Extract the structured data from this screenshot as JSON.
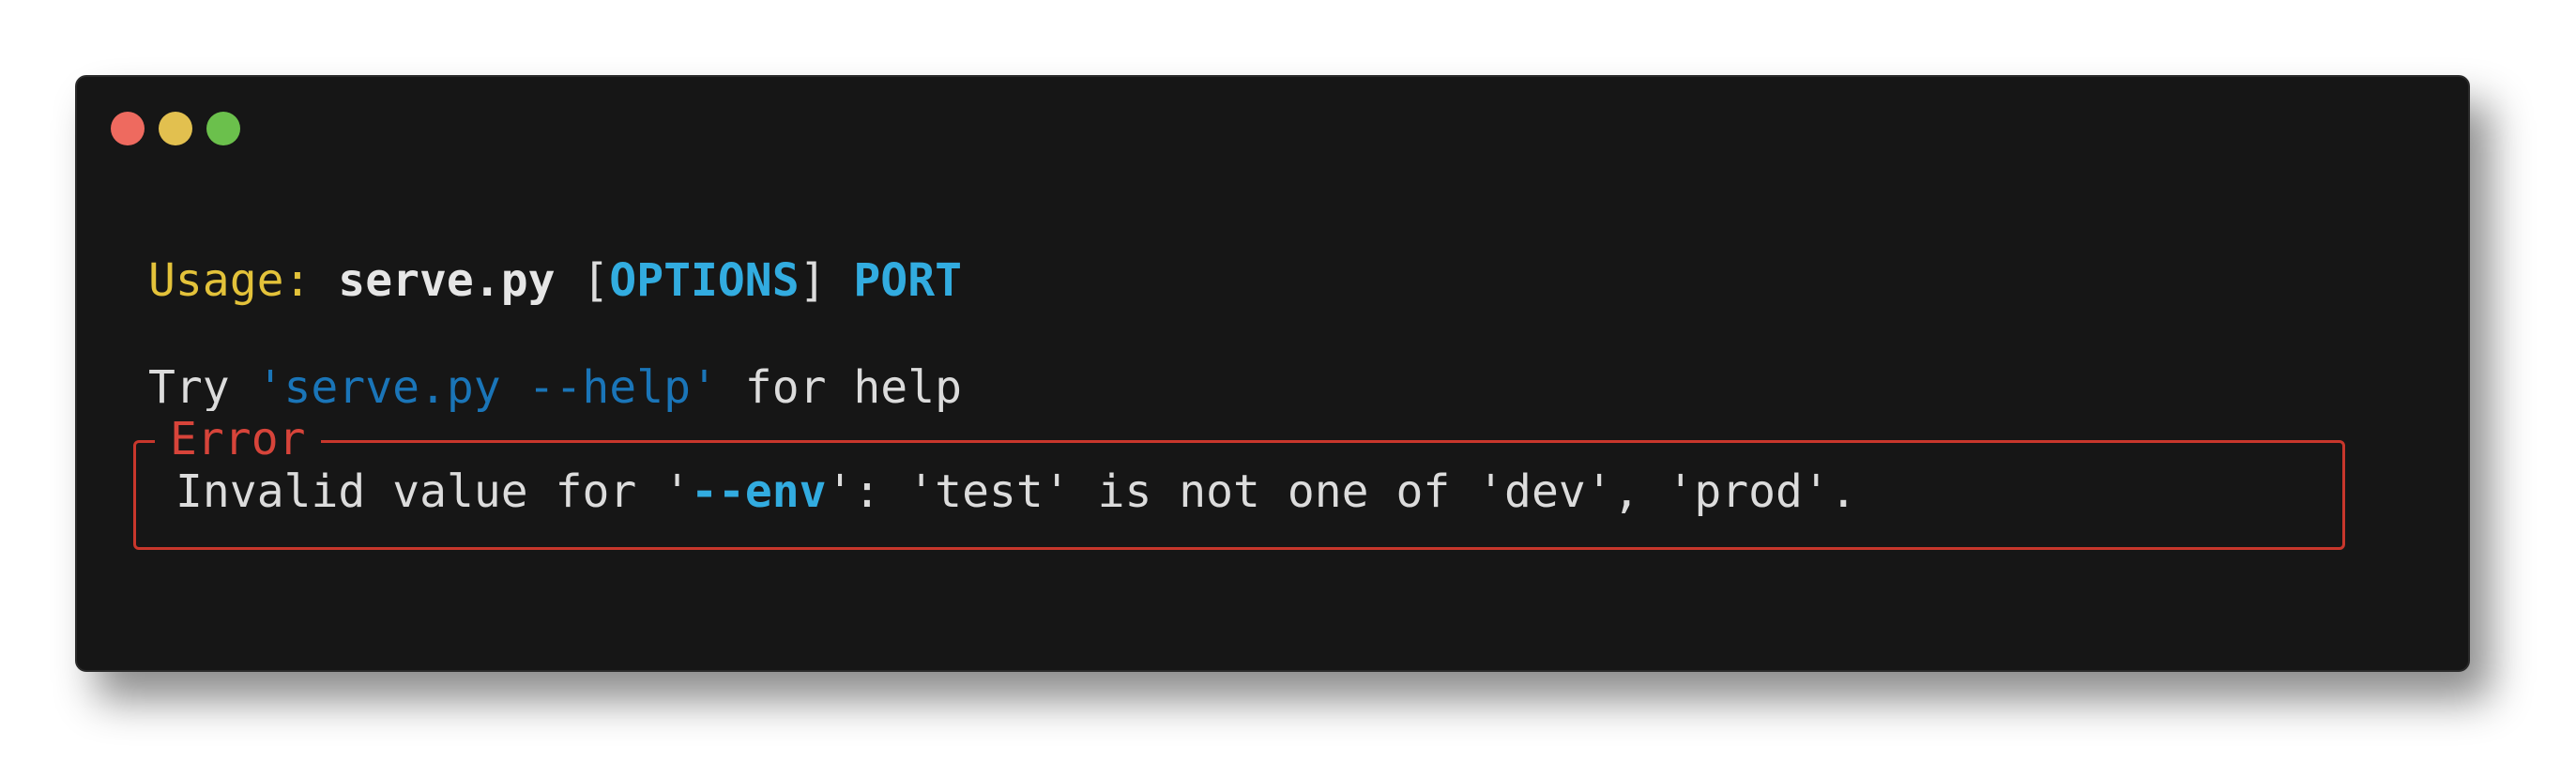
{
  "window": {
    "controls": [
      "close",
      "minimize",
      "maximize"
    ],
    "colors": {
      "close": "#ee6a5f",
      "minimize": "#e2c04f",
      "maximize": "#6bc04c"
    }
  },
  "terminal": {
    "usage": {
      "label": "Usage:",
      "script": "serve.py",
      "open_bracket": "[",
      "options": "OPTIONS",
      "close_bracket": "]",
      "port": "PORT"
    },
    "hint": {
      "prefix": "Try",
      "command": "'serve.py --help'",
      "suffix": "for help"
    },
    "error": {
      "title": "Error",
      "msg_before": "Invalid value for '",
      "option": "--env",
      "msg_after": "': 'test' is not one of 'dev', 'prod'."
    }
  }
}
